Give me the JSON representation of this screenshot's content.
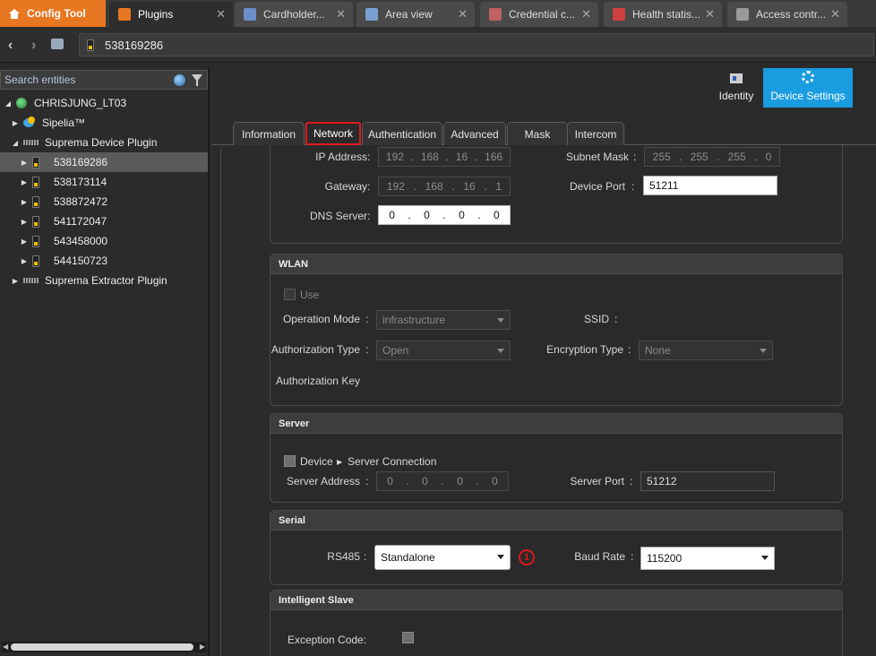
{
  "app_tab": {
    "label": "Config Tool"
  },
  "tabs": [
    {
      "label": "Plugins",
      "color": "#e87722"
    },
    {
      "label": "Cardholder...",
      "color": "#6a8fc9"
    },
    {
      "label": "Area view",
      "color": "#7aa0d0"
    },
    {
      "label": "Credential c...",
      "color": "#c06060"
    },
    {
      "label": "Health statis...",
      "color": "#d04040"
    },
    {
      "label": "Access contr...",
      "color": "#999999"
    }
  ],
  "address": {
    "value": "538169286"
  },
  "sidebar": {
    "search_placeholder": "Search entities",
    "items": [
      {
        "label": "CHRISJUNG_LT03"
      },
      {
        "label": "Sipelia™"
      },
      {
        "label": "Suprema Device Plugin"
      },
      {
        "label": "538169286"
      },
      {
        "label": "538173114"
      },
      {
        "label": "538872472"
      },
      {
        "label": "541172047"
      },
      {
        "label": "543458000"
      },
      {
        "label": "544150723"
      },
      {
        "label": "Suprema Extractor Plugin"
      }
    ]
  },
  "views": {
    "identity": "Identity",
    "device_settings": "Device Settings"
  },
  "subtabs": [
    "Information",
    "Network",
    "Authentication",
    "Advanced",
    "Mask",
    "Intercom"
  ],
  "network": {
    "ip_label": "IP Address",
    "ip": [
      "192",
      "168",
      "16",
      "166"
    ],
    "subnet_label": "Subnet Mask",
    "subnet": [
      "255",
      "255",
      "255",
      "0"
    ],
    "gateway_label": "Gateway",
    "gateway": [
      "192",
      "168",
      "16",
      "1"
    ],
    "device_port_label": "Device Port",
    "device_port": "51211",
    "dns_label": "DNS Server",
    "dns": [
      "0",
      "0",
      "0",
      "0"
    ]
  },
  "wlan": {
    "title": "WLAN",
    "use_label": "Use",
    "op_mode_label": "Operation Mode",
    "op_mode": "infrastructure",
    "ssid_label": "SSID",
    "auth_type_label": "Authorization Type",
    "auth_type": "Open",
    "enc_type_label": "Encryption Type",
    "enc_type": "None",
    "auth_key_label": "Authorization Key"
  },
  "server": {
    "title": "Server",
    "conn_device": "Device",
    "conn_server": "Server Connection",
    "address_label": "Server Address",
    "address": [
      "0",
      "0",
      "0",
      "0"
    ],
    "port_label": "Server Port",
    "port": "51212"
  },
  "serial": {
    "title": "Serial",
    "rs485_label": "RS485",
    "rs485": "Standalone",
    "badge": "1",
    "baud_label": "Baud Rate",
    "baud": "115200"
  },
  "slave": {
    "title": "Intelligent Slave",
    "exception_label": "Exception Code:"
  },
  "colors": {
    "accent": "#1a9ce0",
    "app_orange": "#e87722",
    "highlight": "#e0171f"
  }
}
